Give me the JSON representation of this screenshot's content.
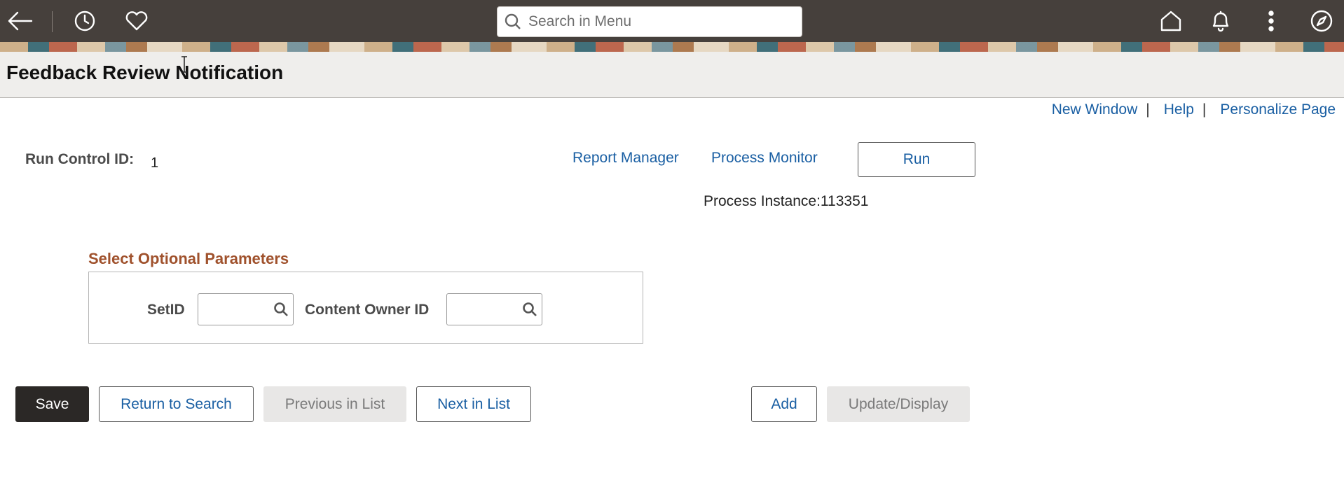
{
  "header": {
    "search_placeholder": "Search in Menu",
    "icons": [
      "back-arrow-icon",
      "history-icon",
      "favorites-heart-icon",
      "search-icon",
      "home-icon",
      "notifications-bell-icon",
      "more-actions-icon",
      "navigator-compass-icon"
    ]
  },
  "page": {
    "title": "Feedback Review Notification"
  },
  "toplinks": {
    "new_window": "New Window",
    "help": "Help",
    "personalize": "Personalize Page",
    "separator": "|"
  },
  "run_control": {
    "label": "Run Control ID:",
    "value": "1",
    "report_manager": "Report Manager",
    "process_monitor": "Process Monitor",
    "run_button": "Run",
    "process_instance_label": "Process Instance:",
    "process_instance_value": "113351"
  },
  "parameters": {
    "section_title": "Select Optional Parameters",
    "setid_label": "SetID",
    "setid_value": "",
    "content_owner_label": "Content Owner ID",
    "content_owner_value": ""
  },
  "actions": {
    "save": "Save",
    "return_to_search": "Return to Search",
    "previous_in_list": "Previous in List",
    "next_in_list": "Next in List",
    "add": "Add",
    "update_display": "Update/Display"
  },
  "colors": {
    "header_bg": "#46403c",
    "link": "#1a5fa3",
    "section_title": "#a0522d",
    "primary_button": "#2b2826"
  }
}
